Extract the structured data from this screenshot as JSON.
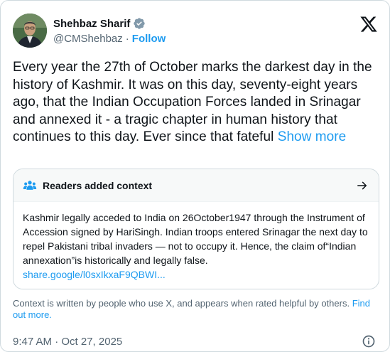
{
  "author": {
    "name": "Shehbaz Sharif",
    "handle": "@CMShehbaz",
    "separator": "·",
    "follow_label": "Follow"
  },
  "tweet": {
    "text": "Every year the 27th of October marks the darkest day in the history of Kashmir. It was on this day, seventy-eight years ago, that the Indian Occupation Forces landed in Srinagar and annexed it - a tragic chapter in human history that continues to this day. Ever since that fateful",
    "show_more_label": "Show more"
  },
  "community_note": {
    "title": "Readers added context",
    "body": "Kashmir legally acceded to India on 26October1947 through the Instrument of Accession signed by HariSingh. Indian troops entered Srinagar the next day to repel Pakistani tribal invaders — not to occupy it. Hence, the claim of“Indian annexation”is historically and legally false.",
    "link": "share.google/l0sxIkxaF9QBWI..."
  },
  "context_notice": {
    "text": "Context is written by people who use X, and appears when rated helpful by others.",
    "find_out_more_label": "Find out more."
  },
  "timestamp": "9:47 AM · Oct 27, 2025",
  "colors": {
    "accent": "#1d9bf0",
    "text": "#0f1419",
    "muted": "#536471",
    "border": "#cfd9de",
    "note_header_bg": "#f7f9f9"
  },
  "icons": {
    "verified": "verified-badge-icon",
    "logo": "x-logo-icon",
    "note": "people-icon",
    "open": "arrow-right-icon",
    "info": "info-icon"
  }
}
